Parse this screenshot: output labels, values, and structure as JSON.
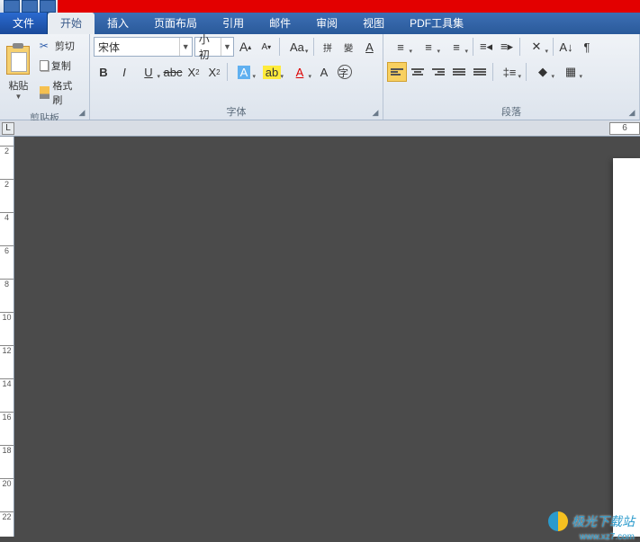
{
  "tabs": {
    "file": "文件",
    "home": "开始",
    "insert": "插入",
    "layout": "页面布局",
    "references": "引用",
    "mail": "邮件",
    "review": "审阅",
    "view": "视图",
    "pdf": "PDF工具集"
  },
  "clipboard": {
    "paste": "粘贴",
    "cut": "剪切",
    "copy": "复制",
    "format_painter": "格式刷",
    "group_label": "剪贴板"
  },
  "font": {
    "name": "宋体",
    "size": "小初",
    "group_label": "字体"
  },
  "paragraph": {
    "group_label": "段落"
  },
  "hruler_right": "6",
  "vruler_ticks": [
    "2",
    "2",
    "4",
    "6",
    "8",
    "10",
    "12",
    "14",
    "16",
    "18",
    "20",
    "22"
  ],
  "watermark": {
    "text": "极光下载站",
    "url": "www.xz7.com"
  }
}
